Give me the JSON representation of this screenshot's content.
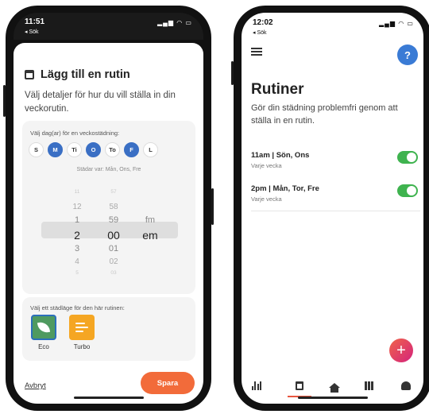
{
  "left_screen": {
    "status_time": "11:51",
    "back_label": "◂ Sök",
    "title": "Lägg till en rutin",
    "description": "Välj detaljer för hur du vill ställa in din veckorutin.",
    "days_label": "Välj dag(ar) för en veckostädning:",
    "days": [
      {
        "label": "S",
        "selected": false
      },
      {
        "label": "M",
        "selected": true
      },
      {
        "label": "Ti",
        "selected": false
      },
      {
        "label": "O",
        "selected": true
      },
      {
        "label": "To",
        "selected": false
      },
      {
        "label": "F",
        "selected": true
      },
      {
        "label": "L",
        "selected": false
      }
    ],
    "cleans_summary": "Städar var: Mån, Ons, Fre",
    "time_picker": {
      "rows": [
        {
          "h": "11",
          "m": "57",
          "ap": ""
        },
        {
          "h": "12",
          "m": "58",
          "ap": ""
        },
        {
          "h": "1",
          "m": "59",
          "ap": "fm"
        },
        {
          "h": "2",
          "m": "00",
          "ap": "em"
        },
        {
          "h": "3",
          "m": "01",
          "ap": ""
        },
        {
          "h": "4",
          "m": "02",
          "ap": ""
        },
        {
          "h": "5",
          "m": "03",
          "ap": ""
        }
      ]
    },
    "mode_label": "Välj ett städläge för den här rutinen:",
    "modes": [
      {
        "label": "Eco",
        "selected": true
      },
      {
        "label": "Turbo",
        "selected": false
      }
    ],
    "cancel_label": "Avbryt",
    "save_label": "Spara"
  },
  "right_screen": {
    "status_time": "12:02",
    "back_label": "◂ Sök",
    "help_label": "?",
    "title": "Rutiner",
    "subtitle": "Gör din städning problemfri genom att ställa in en rutin.",
    "routines": [
      {
        "title": "11am | Sön, Ons",
        "sub": "Varje vecka",
        "enabled": true
      },
      {
        "title": "2pm | Mån, Tor, Fre",
        "sub": "Varje vecka",
        "enabled": true
      }
    ],
    "fab_label": "+",
    "tabs": [
      "stats-icon",
      "calendar-icon",
      "home-icon",
      "map-icon",
      "robot-icon"
    ],
    "active_tab": "calendar-icon"
  },
  "colors": {
    "accent_orange": "#f26b3a",
    "day_selected": "#3a6fc4",
    "toggle_on": "#3fb34f",
    "help_blue": "#3a7bd5"
  }
}
